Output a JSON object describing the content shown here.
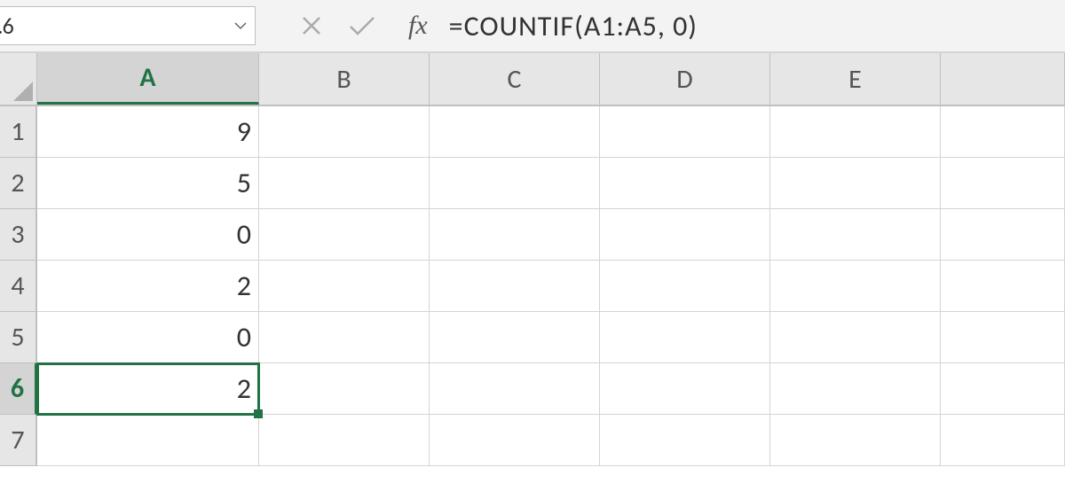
{
  "formulaBar": {
    "nameBoxText": ".6",
    "fxLabel": "fx",
    "formula": "=COUNTIF(A1:A5, 0)"
  },
  "columns": [
    "A",
    "B",
    "C",
    "D",
    "E"
  ],
  "rows": [
    "1",
    "2",
    "3",
    "4",
    "5",
    "6",
    "7"
  ],
  "activeCell": "A6",
  "activeRow": "6",
  "activeCol": "A",
  "cells": {
    "A1": "9",
    "A2": "5",
    "A3": "0",
    "A4": "2",
    "A5": "0",
    "A6": "2"
  }
}
